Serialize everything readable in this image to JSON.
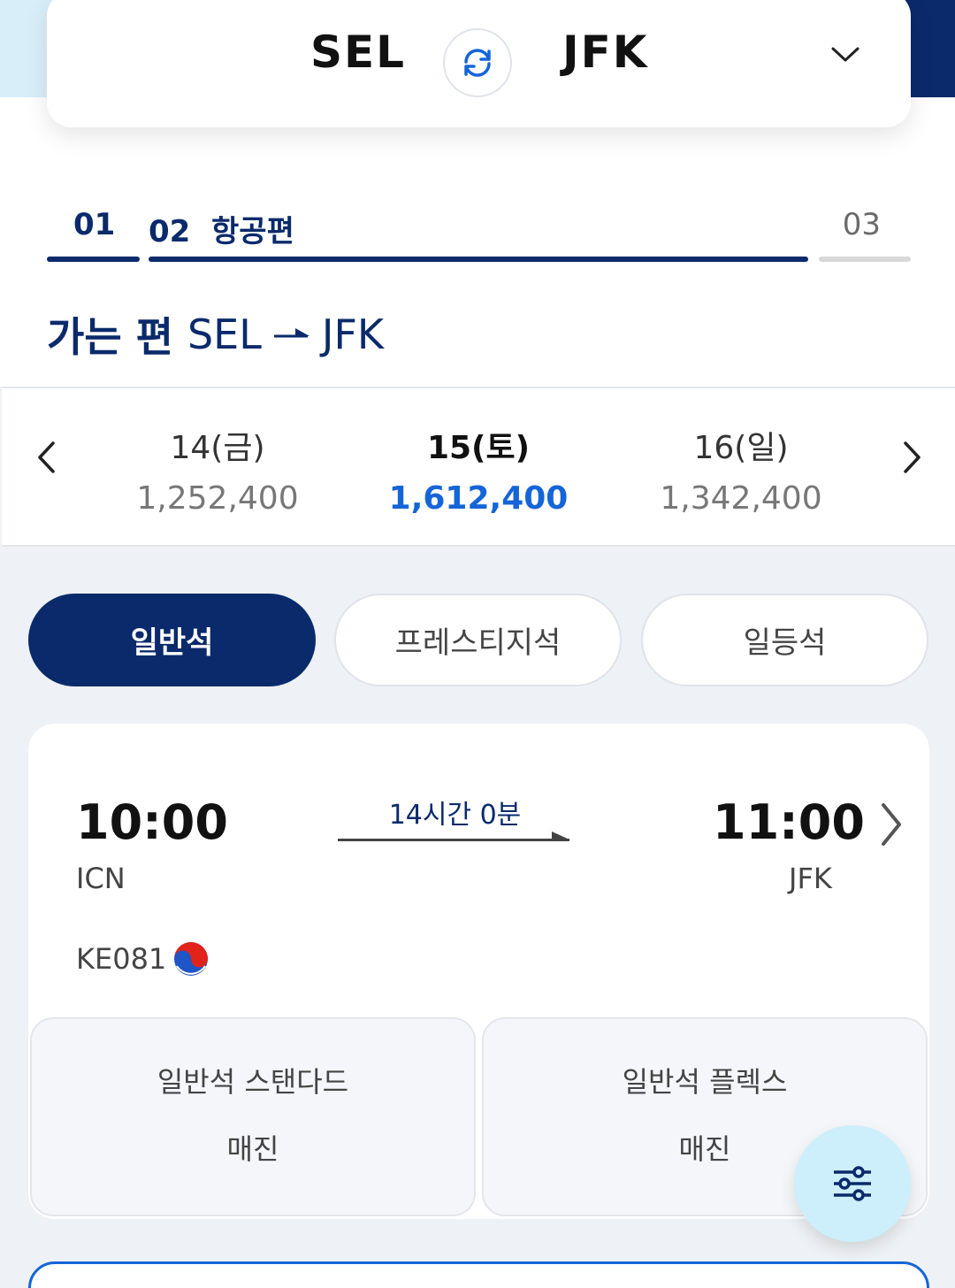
{
  "route": {
    "from": "SEL",
    "to": "JFK",
    "swap_icon": "swap-icon",
    "expand_icon": "chevron-down-icon"
  },
  "steps": {
    "step1": "01",
    "step2": "02",
    "step2_label": "항공편",
    "step3": "03",
    "current": 2
  },
  "direction": {
    "label": "가는 편",
    "from": "SEL",
    "to": "JFK"
  },
  "dates": [
    {
      "day": "14(금)",
      "price": "1,252,400",
      "selected": false
    },
    {
      "day": "15(토)",
      "price": "1,612,400",
      "selected": true
    },
    {
      "day": "16(일)",
      "price": "1,342,400",
      "selected": false
    }
  ],
  "classes": [
    {
      "label": "일반석",
      "selected": true
    },
    {
      "label": "프레스티지석",
      "selected": false
    },
    {
      "label": "일등석",
      "selected": false
    }
  ],
  "flight": {
    "dep_time": "10:00",
    "dep_airport": "ICN",
    "arr_time": "11:00",
    "arr_airport": "JFK",
    "duration": "14시간 0분",
    "flight_number": "KE081",
    "fares": [
      {
        "name": "일반석 스탠다드",
        "status": "매진"
      },
      {
        "name": "일반석 플렉스",
        "status": "매진"
      }
    ]
  },
  "colors": {
    "navy": "#0a2a6b",
    "accent_blue": "#1565d8",
    "light_blue": "#cdeefb",
    "background_gray": "#eef1f5"
  },
  "icons": {
    "prev_date": "chevron-left-icon",
    "next_date": "chevron-right-icon",
    "card_detail": "chevron-right-icon",
    "airline_logo": "korean-air-logo",
    "filter": "filter-sliders-icon"
  }
}
